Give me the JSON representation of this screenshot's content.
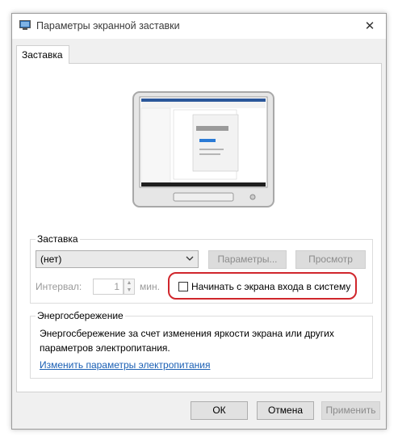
{
  "window": {
    "title": "Параметры экранной заставки",
    "close_glyph": "✕"
  },
  "tab": {
    "label": "Заставка"
  },
  "screensaver_group": {
    "label": "Заставка",
    "selected": "(нет)",
    "settings_button": "Параметры...",
    "preview_button": "Просмотр",
    "interval_label": "Интервал:",
    "interval_value": "1",
    "interval_unit": "мин.",
    "logon_checkbox_label": "Начинать с экрана входа в систему",
    "logon_checked": false
  },
  "power_group": {
    "label": "Энергосбережение",
    "description": "Энергосбережение за счет изменения яркости экрана или других параметров электропитания.",
    "link": "Изменить параметры электропитания"
  },
  "buttons": {
    "ok": "ОК",
    "cancel": "Отмена",
    "apply": "Применить"
  },
  "colors": {
    "highlight": "#d0262c",
    "link": "#1a5fb4"
  }
}
